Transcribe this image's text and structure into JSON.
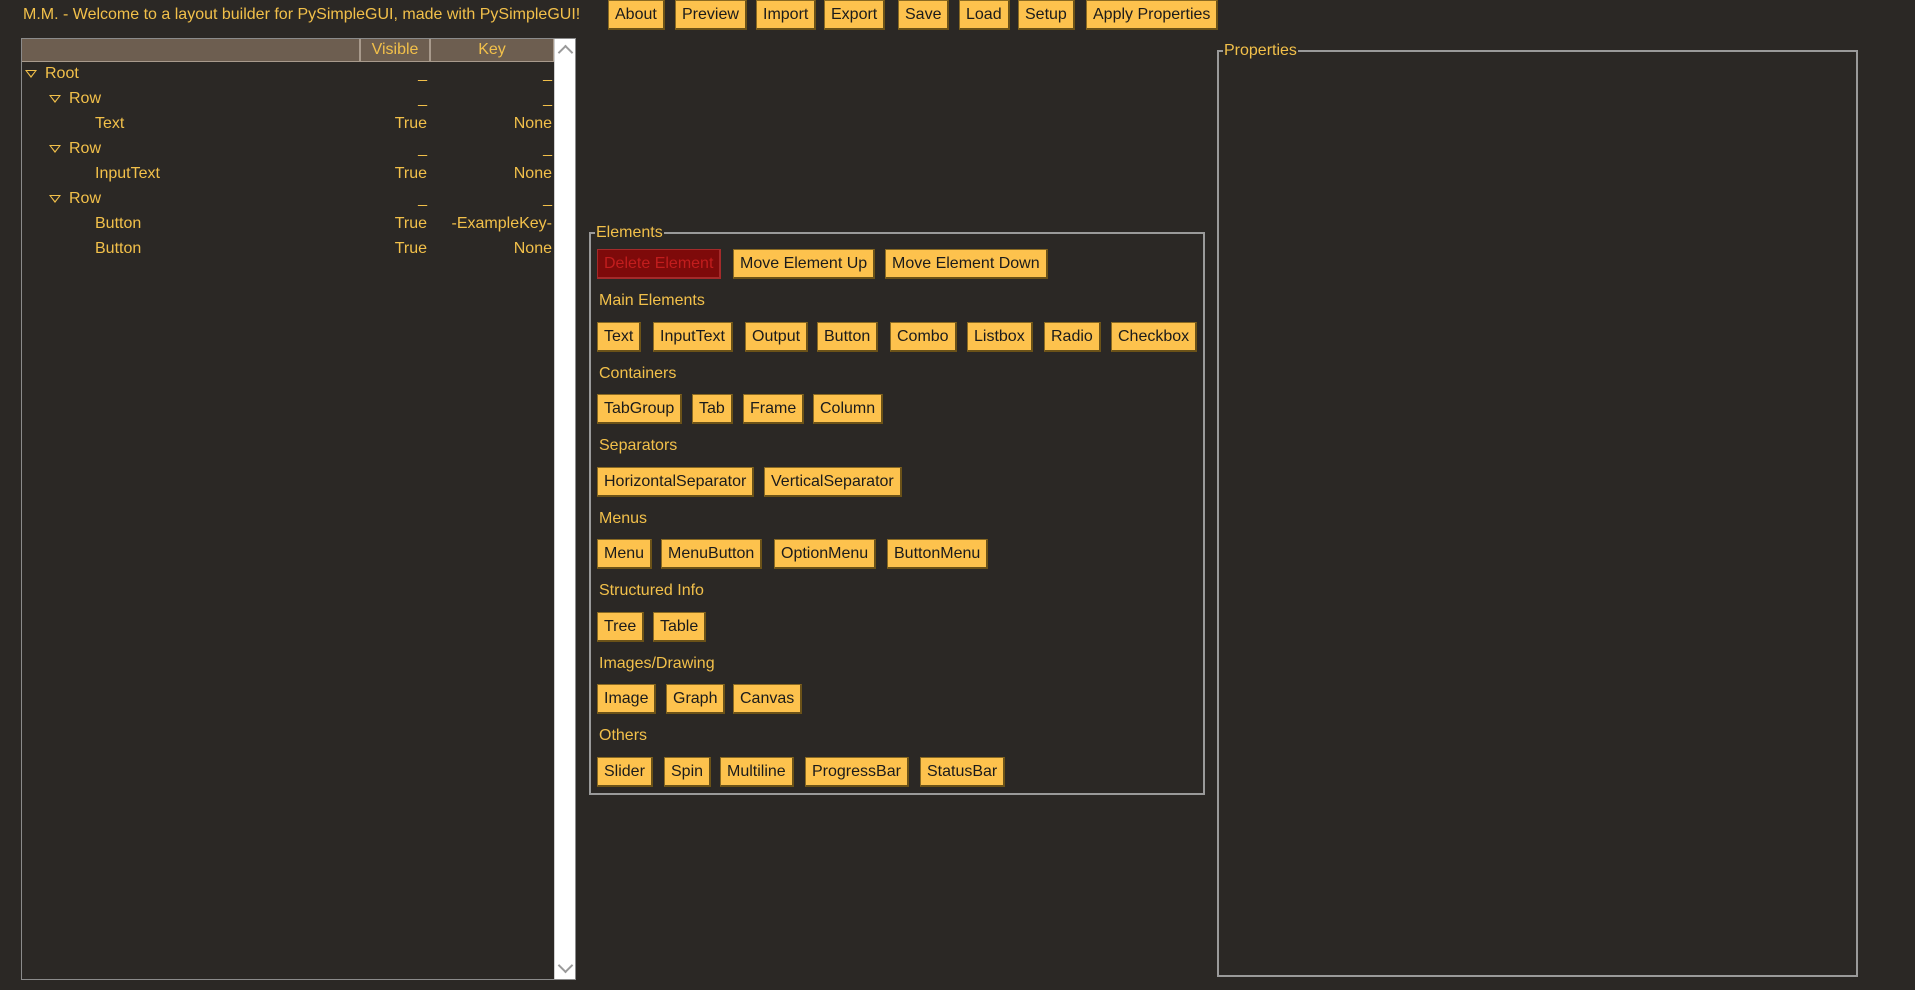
{
  "header": {
    "welcome": "M.M. - Welcome to a layout builder for PySimpleGUI, made with PySimpleGUI!",
    "buttons": [
      "About",
      "Preview",
      "Import",
      "Export",
      "Save",
      "Load",
      "Setup",
      "Apply Properties"
    ]
  },
  "tree": {
    "columns": [
      "",
      "Visible",
      "Key"
    ],
    "rows": [
      {
        "label": "Root",
        "visible": "_",
        "key": "_"
      },
      {
        "label": "Row",
        "visible": "_",
        "key": "_"
      },
      {
        "label": "Text",
        "visible": "True",
        "key": "None"
      },
      {
        "label": "Row",
        "visible": "_",
        "key": "_"
      },
      {
        "label": "InputText",
        "visible": "True",
        "key": "None"
      },
      {
        "label": "Row",
        "visible": "_",
        "key": "_"
      },
      {
        "label": "Button",
        "visible": "True",
        "key": "-ExampleKey-"
      },
      {
        "label": "Button",
        "visible": "True",
        "key": "None"
      }
    ]
  },
  "elements": {
    "title": "Elements",
    "actions": [
      "Delete Element",
      "Move Element Up",
      "Move Element Down"
    ],
    "sections": [
      {
        "label": "Main Elements",
        "buttons": [
          "Text",
          "InputText",
          "Output",
          "Button",
          "Combo",
          "Listbox",
          "Radio",
          "Checkbox"
        ]
      },
      {
        "label": "Containers",
        "buttons": [
          "TabGroup",
          "Tab",
          "Frame",
          "Column"
        ]
      },
      {
        "label": "Separators",
        "buttons": [
          "HorizontalSeparator",
          "VerticalSeparator"
        ]
      },
      {
        "label": "Menus",
        "buttons": [
          "Menu",
          "MenuButton",
          "OptionMenu",
          "ButtonMenu"
        ]
      },
      {
        "label": "Structured Info",
        "buttons": [
          "Tree",
          "Table"
        ]
      },
      {
        "label": "Images/Drawing",
        "buttons": [
          "Image",
          "Graph",
          "Canvas"
        ]
      },
      {
        "label": "Others",
        "buttons": [
          "Slider",
          "Spin",
          "Multiline",
          "ProgressBar",
          "StatusBar"
        ]
      }
    ]
  },
  "properties": {
    "title": "Properties"
  },
  "colors": {
    "background": "#2b2825",
    "text": "#f2c04a",
    "button": "#fdc24d",
    "danger_button": "#7e0a0a"
  }
}
